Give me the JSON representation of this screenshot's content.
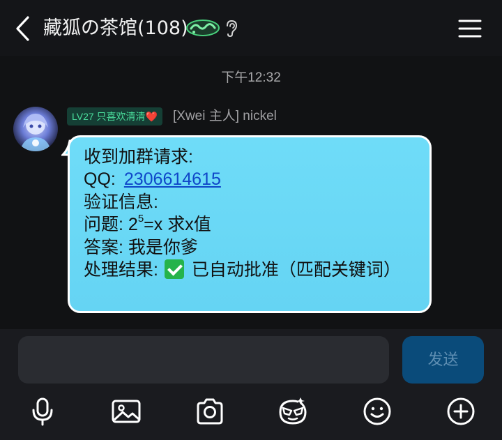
{
  "header": {
    "title": "藏狐の茶馆(108)",
    "back_icon": "chevron-left-icon",
    "badge_icon": "captain-badge-icon",
    "ear_icon": "ear-icon",
    "menu_icon": "hamburger-menu-icon"
  },
  "chat": {
    "timestamp": "下午12:32",
    "message": {
      "level_badge": "LV27 只喜欢清清",
      "heart": "❤️",
      "sender": "[Xwei 主人] nickel",
      "lines": {
        "request": "收到加群请求:",
        "qq_label": "QQ:",
        "qq_value": "2306614615",
        "verify": "验证信息:",
        "question_label": "问题:",
        "question_base": "2",
        "question_exp": "5",
        "question_rest": "=x 求x值",
        "answer": "答案: 我是你爹",
        "result_label": "处理结果:",
        "result_value": "已自动批准（匹配关键词）"
      }
    }
  },
  "composer": {
    "input_value": "",
    "send_label": "发送"
  },
  "toolbar": {
    "icons": [
      "microphone-icon",
      "image-icon",
      "camera-icon",
      "sticker-icon",
      "emoji-icon",
      "plus-icon"
    ]
  },
  "colors": {
    "background": "#111214",
    "bubble": "#6fdcf8",
    "link": "#0f47c9",
    "level_badge_text": "#4ade9c",
    "send_button": "#0a4b7a"
  }
}
